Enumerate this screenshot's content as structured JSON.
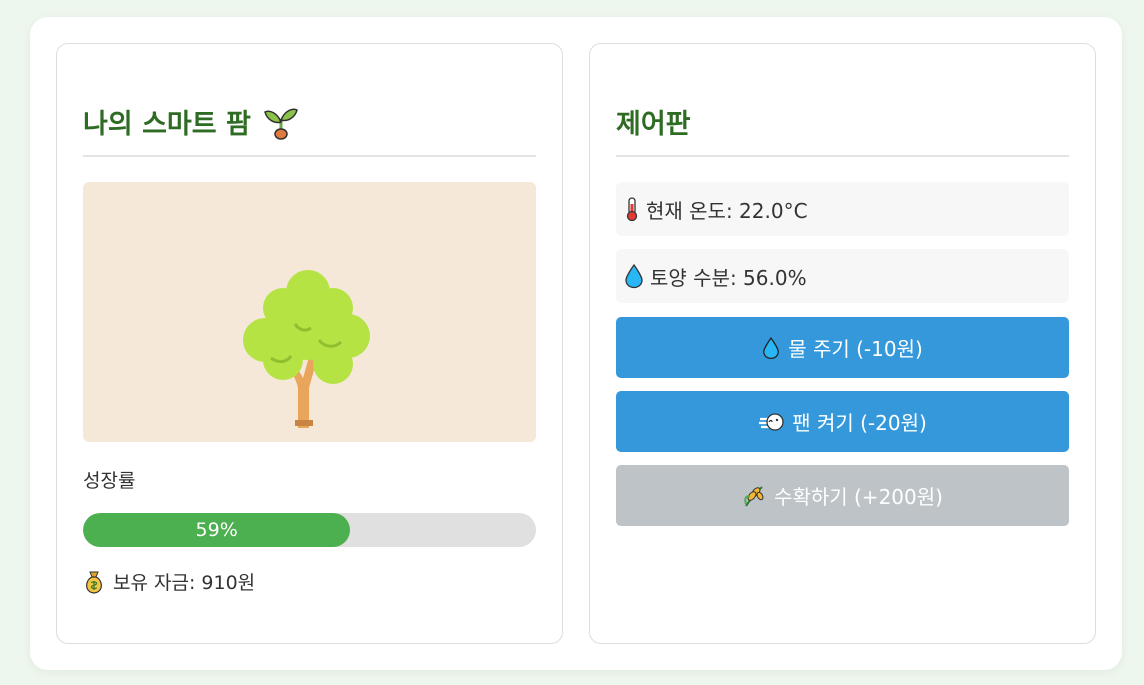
{
  "farm": {
    "title": "나의 스마트 팜",
    "title_icon": "seedling-icon",
    "plant_icon": "tree-icon",
    "growth_label": "성장률",
    "growth_percent": 59,
    "growth_text": "59%",
    "money_icon": "money-bag-icon",
    "money_text": "보유 자금: 910원"
  },
  "control": {
    "title": "제어판",
    "temperature_icon": "thermometer-icon",
    "temperature_text": "현재 온도: 22.0°C",
    "moisture_icon": "droplet-icon",
    "moisture_text": "토양 수분: 56.0%",
    "water_button": "물 주기 (-10원)",
    "fan_button": "팬 켜기 (-20원)",
    "harvest_button": "수확하기 (+200원)"
  },
  "colors": {
    "title_green": "#2e6b23",
    "progress_green": "#4caf50",
    "button_blue": "#3498db",
    "button_gray": "#bdc3c7",
    "plant_background": "#f6e8d9"
  }
}
